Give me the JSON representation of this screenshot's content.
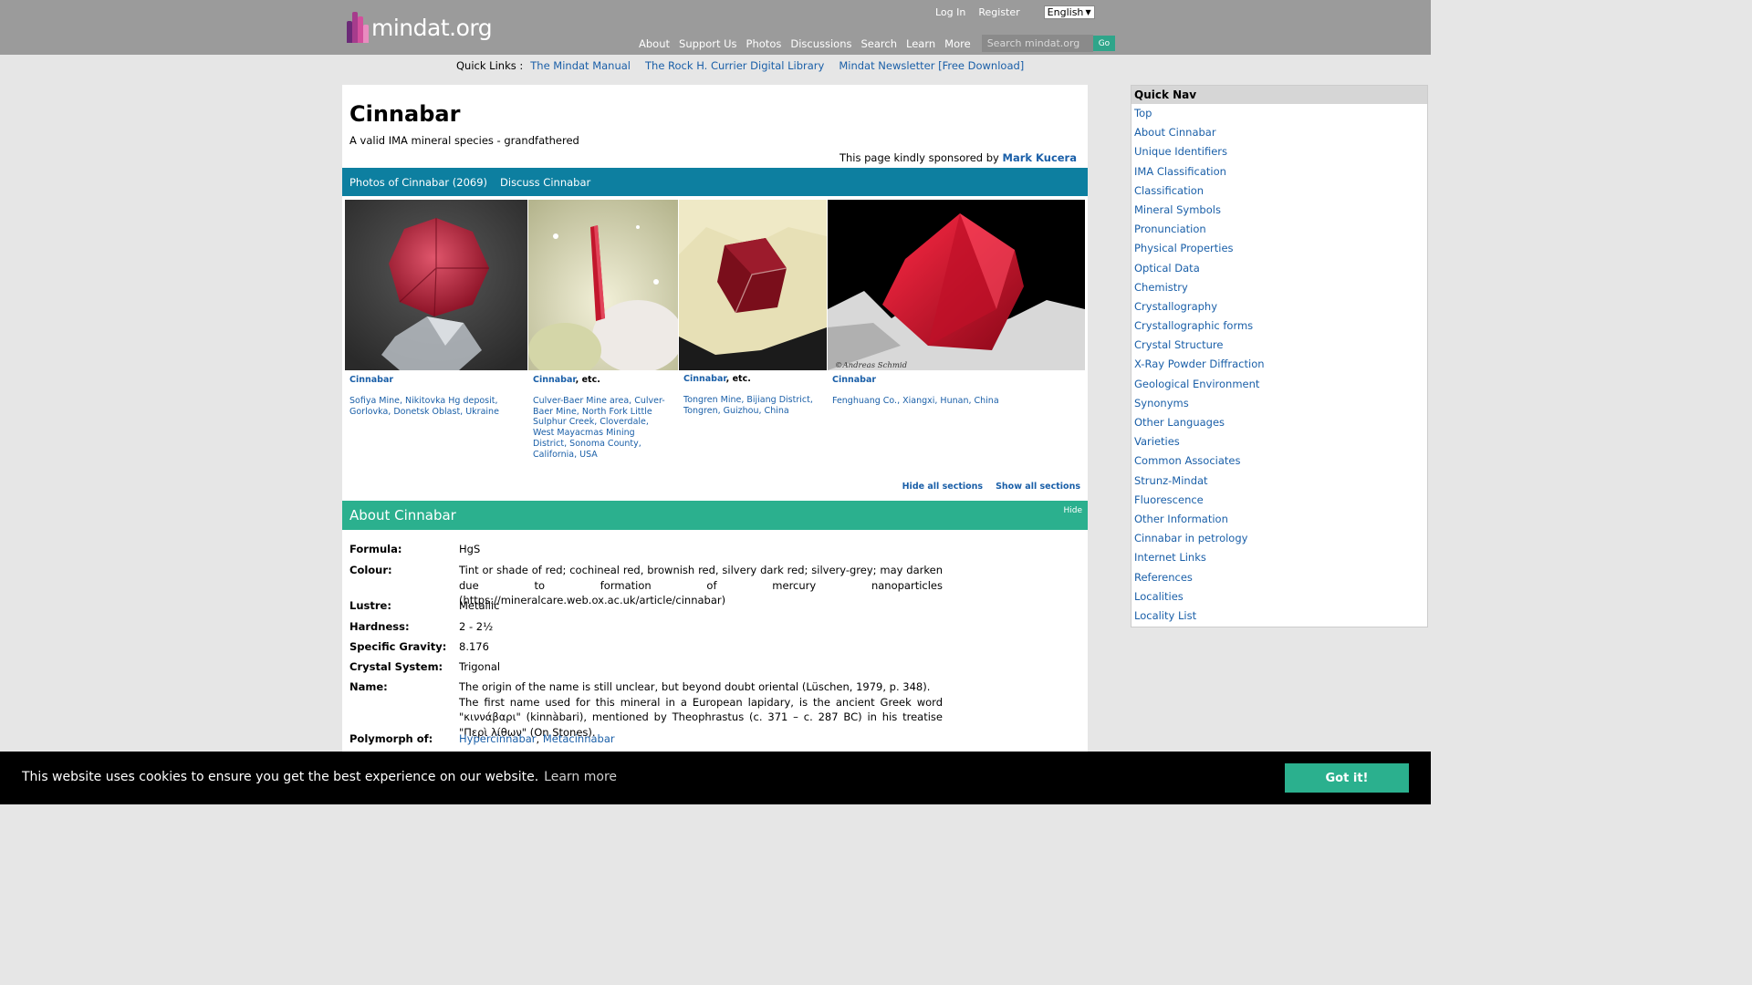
{
  "header": {
    "logo_text": "mindat.org",
    "login": "Log In",
    "register": "Register",
    "language": "English",
    "nav": [
      "About",
      "Support Us",
      "Photos",
      "Discussions",
      "Search",
      "Learn",
      "More"
    ],
    "search_placeholder": "Search mindat.org",
    "go": "Go"
  },
  "quicklinks": {
    "label": "Quick Links :",
    "links": [
      "The Mindat Manual",
      "The Rock H. Currier Digital Library",
      "Mindat Newsletter [Free Download]"
    ]
  },
  "mineral": {
    "title": "Cinnabar",
    "subtitle": "A valid IMA mineral species - grandfathered",
    "sponsor_text": "This page kindly sponsored by",
    "sponsor_name": "Mark Kucera"
  },
  "tabs": [
    "Photos of Cinnabar (2069)",
    "Discuss Cinnabar"
  ],
  "photos": [
    {
      "name": "Cinnabar",
      "etc": "",
      "locality": "Sofiya Mine, Nikitovka Hg deposit, Gorlovka, Donetsk Oblast, Ukraine"
    },
    {
      "name": "Cinnabar",
      "etc": ", etc.",
      "locality": "Culver-Baer Mine area, Culver-Baer Mine, North Fork Little Sulphur Creek, Cloverdale, West Mayacmas Mining District, Sonoma County, California, USA"
    },
    {
      "name": "Cinnabar",
      "etc": ", etc.",
      "locality": "Tongren Mine, Bijiang District, Tongren, Guizhou, China"
    },
    {
      "name": "Cinnabar",
      "etc": "",
      "locality": "Fenghuang Co., Xiangxi, Hunan, China",
      "credit": "©Andreas Schmid"
    }
  ],
  "section_controls": {
    "hide_all": "Hide all sections",
    "show_all": "Show all sections"
  },
  "about": {
    "heading": "About Cinnabar",
    "hide": "Hide",
    "rows": [
      {
        "k": "Formula:",
        "v": "HgS"
      },
      {
        "k": "Colour:",
        "v": "Tint or shade of red; cochineal red, brownish red, silvery dark red; silvery-grey; may darken due to formation of mercury nanoparticles (https://mineralcare.web.ox.ac.uk/article/cinnabar)"
      },
      {
        "k": "Lustre:",
        "v": "Metallic"
      },
      {
        "k": "Hardness:",
        "v": "2 - 2½"
      },
      {
        "k": "Specific Gravity:",
        "v": "8.176"
      },
      {
        "k": "Crystal System:",
        "v": "Trigonal"
      },
      {
        "k": "Name:",
        "v": "The origin of the name is still unclear, but beyond doubt oriental (Lüschen, 1979, p. 348).",
        "v2": "The first name used for this mineral in a European lapidary, is the ancient Greek word \"κιννάβαρι\" (kinnàbari), mentioned by Theophrastus (c. 371 – c. 287 BC) in his treatise \"Περὶ λίθων\" (On Stones)."
      },
      {
        "k": "Polymorph of:",
        "links": [
          "Hypercinnabar",
          "Metacinnabar"
        ],
        "sep": ", "
      }
    ]
  },
  "quicknav": {
    "title": "Quick Nav",
    "items": [
      "Top",
      "About Cinnabar",
      "Unique Identifiers",
      "IMA Classification",
      "Classification",
      "Mineral Symbols",
      "Pronunciation",
      "Physical Properties",
      "Optical Data",
      "Chemistry",
      "Crystallography",
      "Crystallographic forms",
      "Crystal Structure",
      "X-Ray Powder Diffraction",
      "Geological Environment",
      "Synonyms",
      "Other Languages",
      "Varieties",
      "Common Associates",
      "Strunz-Mindat",
      "Fluorescence",
      "Other Information",
      "Cinnabar in petrology",
      "Internet Links",
      "References",
      "Localities",
      "Locality List"
    ]
  },
  "cookie": {
    "message": "This website uses cookies to ensure you get the best experience on our website.",
    "learn_more": "Learn more",
    "button": "Got it!"
  }
}
